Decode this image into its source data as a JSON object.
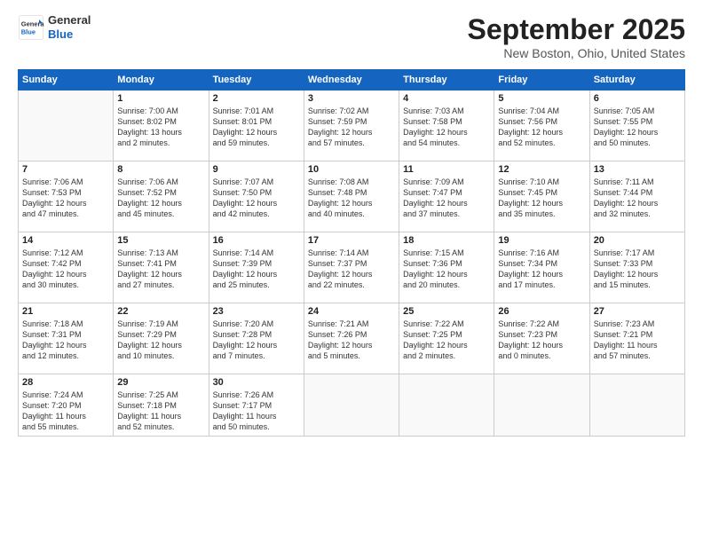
{
  "logo": {
    "general": "General",
    "blue": "Blue"
  },
  "header": {
    "month": "September 2025",
    "location": "New Boston, Ohio, United States"
  },
  "weekdays": [
    "Sunday",
    "Monday",
    "Tuesday",
    "Wednesday",
    "Thursday",
    "Friday",
    "Saturday"
  ],
  "weeks": [
    [
      {
        "day": "",
        "info": ""
      },
      {
        "day": "1",
        "info": "Sunrise: 7:00 AM\nSunset: 8:02 PM\nDaylight: 13 hours\nand 2 minutes."
      },
      {
        "day": "2",
        "info": "Sunrise: 7:01 AM\nSunset: 8:01 PM\nDaylight: 12 hours\nand 59 minutes."
      },
      {
        "day": "3",
        "info": "Sunrise: 7:02 AM\nSunset: 7:59 PM\nDaylight: 12 hours\nand 57 minutes."
      },
      {
        "day": "4",
        "info": "Sunrise: 7:03 AM\nSunset: 7:58 PM\nDaylight: 12 hours\nand 54 minutes."
      },
      {
        "day": "5",
        "info": "Sunrise: 7:04 AM\nSunset: 7:56 PM\nDaylight: 12 hours\nand 52 minutes."
      },
      {
        "day": "6",
        "info": "Sunrise: 7:05 AM\nSunset: 7:55 PM\nDaylight: 12 hours\nand 50 minutes."
      }
    ],
    [
      {
        "day": "7",
        "info": "Sunrise: 7:06 AM\nSunset: 7:53 PM\nDaylight: 12 hours\nand 47 minutes."
      },
      {
        "day": "8",
        "info": "Sunrise: 7:06 AM\nSunset: 7:52 PM\nDaylight: 12 hours\nand 45 minutes."
      },
      {
        "day": "9",
        "info": "Sunrise: 7:07 AM\nSunset: 7:50 PM\nDaylight: 12 hours\nand 42 minutes."
      },
      {
        "day": "10",
        "info": "Sunrise: 7:08 AM\nSunset: 7:48 PM\nDaylight: 12 hours\nand 40 minutes."
      },
      {
        "day": "11",
        "info": "Sunrise: 7:09 AM\nSunset: 7:47 PM\nDaylight: 12 hours\nand 37 minutes."
      },
      {
        "day": "12",
        "info": "Sunrise: 7:10 AM\nSunset: 7:45 PM\nDaylight: 12 hours\nand 35 minutes."
      },
      {
        "day": "13",
        "info": "Sunrise: 7:11 AM\nSunset: 7:44 PM\nDaylight: 12 hours\nand 32 minutes."
      }
    ],
    [
      {
        "day": "14",
        "info": "Sunrise: 7:12 AM\nSunset: 7:42 PM\nDaylight: 12 hours\nand 30 minutes."
      },
      {
        "day": "15",
        "info": "Sunrise: 7:13 AM\nSunset: 7:41 PM\nDaylight: 12 hours\nand 27 minutes."
      },
      {
        "day": "16",
        "info": "Sunrise: 7:14 AM\nSunset: 7:39 PM\nDaylight: 12 hours\nand 25 minutes."
      },
      {
        "day": "17",
        "info": "Sunrise: 7:14 AM\nSunset: 7:37 PM\nDaylight: 12 hours\nand 22 minutes."
      },
      {
        "day": "18",
        "info": "Sunrise: 7:15 AM\nSunset: 7:36 PM\nDaylight: 12 hours\nand 20 minutes."
      },
      {
        "day": "19",
        "info": "Sunrise: 7:16 AM\nSunset: 7:34 PM\nDaylight: 12 hours\nand 17 minutes."
      },
      {
        "day": "20",
        "info": "Sunrise: 7:17 AM\nSunset: 7:33 PM\nDaylight: 12 hours\nand 15 minutes."
      }
    ],
    [
      {
        "day": "21",
        "info": "Sunrise: 7:18 AM\nSunset: 7:31 PM\nDaylight: 12 hours\nand 12 minutes."
      },
      {
        "day": "22",
        "info": "Sunrise: 7:19 AM\nSunset: 7:29 PM\nDaylight: 12 hours\nand 10 minutes."
      },
      {
        "day": "23",
        "info": "Sunrise: 7:20 AM\nSunset: 7:28 PM\nDaylight: 12 hours\nand 7 minutes."
      },
      {
        "day": "24",
        "info": "Sunrise: 7:21 AM\nSunset: 7:26 PM\nDaylight: 12 hours\nand 5 minutes."
      },
      {
        "day": "25",
        "info": "Sunrise: 7:22 AM\nSunset: 7:25 PM\nDaylight: 12 hours\nand 2 minutes."
      },
      {
        "day": "26",
        "info": "Sunrise: 7:22 AM\nSunset: 7:23 PM\nDaylight: 12 hours\nand 0 minutes."
      },
      {
        "day": "27",
        "info": "Sunrise: 7:23 AM\nSunset: 7:21 PM\nDaylight: 11 hours\nand 57 minutes."
      }
    ],
    [
      {
        "day": "28",
        "info": "Sunrise: 7:24 AM\nSunset: 7:20 PM\nDaylight: 11 hours\nand 55 minutes."
      },
      {
        "day": "29",
        "info": "Sunrise: 7:25 AM\nSunset: 7:18 PM\nDaylight: 11 hours\nand 52 minutes."
      },
      {
        "day": "30",
        "info": "Sunrise: 7:26 AM\nSunset: 7:17 PM\nDaylight: 11 hours\nand 50 minutes."
      },
      {
        "day": "",
        "info": ""
      },
      {
        "day": "",
        "info": ""
      },
      {
        "day": "",
        "info": ""
      },
      {
        "day": "",
        "info": ""
      }
    ]
  ]
}
